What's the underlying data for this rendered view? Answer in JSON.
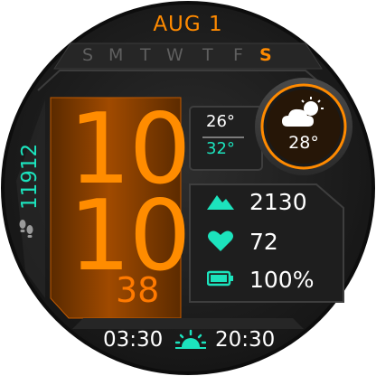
{
  "watch": {
    "date": "AUG 1",
    "weekdays": [
      {
        "label": "S",
        "active": false
      },
      {
        "label": "M",
        "active": false
      },
      {
        "label": "T",
        "active": false
      },
      {
        "label": "W",
        "active": false
      },
      {
        "label": "T",
        "active": false
      },
      {
        "label": "F",
        "active": false
      },
      {
        "label": "S",
        "active": true
      }
    ],
    "time": {
      "hour": "10",
      "minute": "10",
      "second": "38"
    },
    "temperature": {
      "high": "26°",
      "low": "32°",
      "current": "28°"
    },
    "weather_icon": "partly-cloudy-icon",
    "steps": "11912",
    "stats": {
      "elevation": "2130",
      "heart_rate": "72",
      "battery": "100%"
    },
    "sun": {
      "sunrise": "03:30",
      "sunset": "20:30"
    },
    "colors": {
      "accent": "#ff8a00",
      "teal": "#1ce3bd",
      "background": "#1a1a1a"
    }
  }
}
